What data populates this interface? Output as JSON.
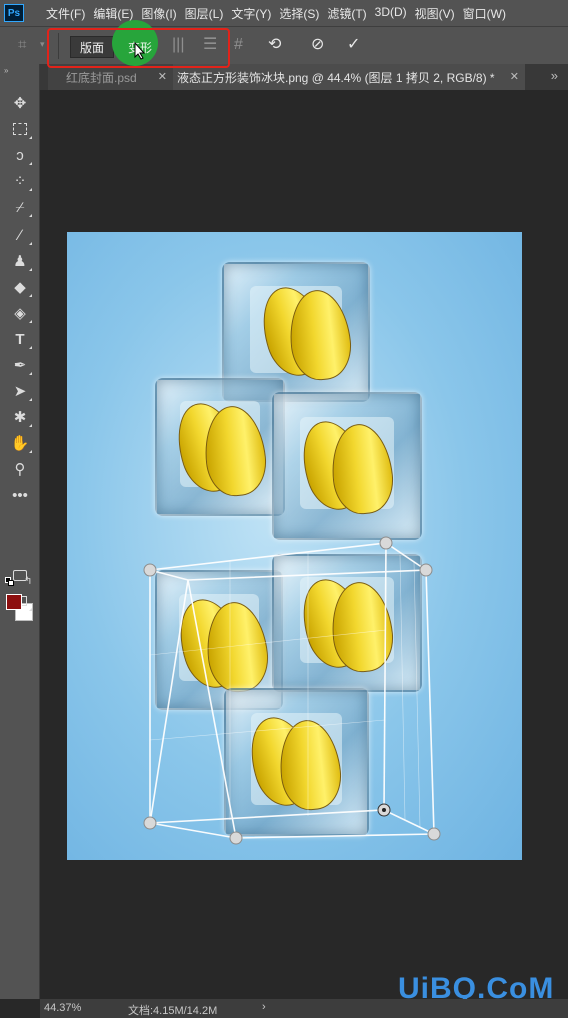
{
  "app": {
    "logo": "Ps"
  },
  "menu": {
    "items": [
      "文件(F)",
      "编辑(E)",
      "图像(I)",
      "图层(L)",
      "文字(Y)",
      "选择(S)",
      "滤镜(T)",
      "3D(D)",
      "视图(V)",
      "窗口(W)"
    ]
  },
  "options": {
    "mode_plane": "版面",
    "mode_warp": "变形",
    "grid_icon": "#",
    "icons": [
      "split-vertical-icon",
      "split-horizontal-icon",
      "grid-icon",
      "reset-icon",
      "cancel-icon",
      "commit-icon"
    ]
  },
  "tabs": [
    {
      "title": "红底封面.psd",
      "active": false
    },
    {
      "title": "液态正方形装饰冰块.png @ 44.4% (图层 1 拷贝 2, RGB/8) *",
      "active": true
    }
  ],
  "tools": [
    "move-icon",
    "marquee-icon",
    "lasso-icon",
    "quick-select-icon",
    "eyedropper-icon",
    "brush-icon",
    "stamp-icon",
    "eraser-icon",
    "fill-icon",
    "type-icon",
    "pen-icon",
    "path-select-icon",
    "shape-icon",
    "hand-icon",
    "zoom-icon",
    "more-icon"
  ],
  "colors": {
    "foreground": "#8d0f0f",
    "background": "#ffffff",
    "highlight": "#e2231a",
    "click_indicator": "#27a53b"
  },
  "status": {
    "zoom": "44.37%",
    "doc": "文档:4.15M/14.2M"
  },
  "watermark": "UiBQ.CoM"
}
